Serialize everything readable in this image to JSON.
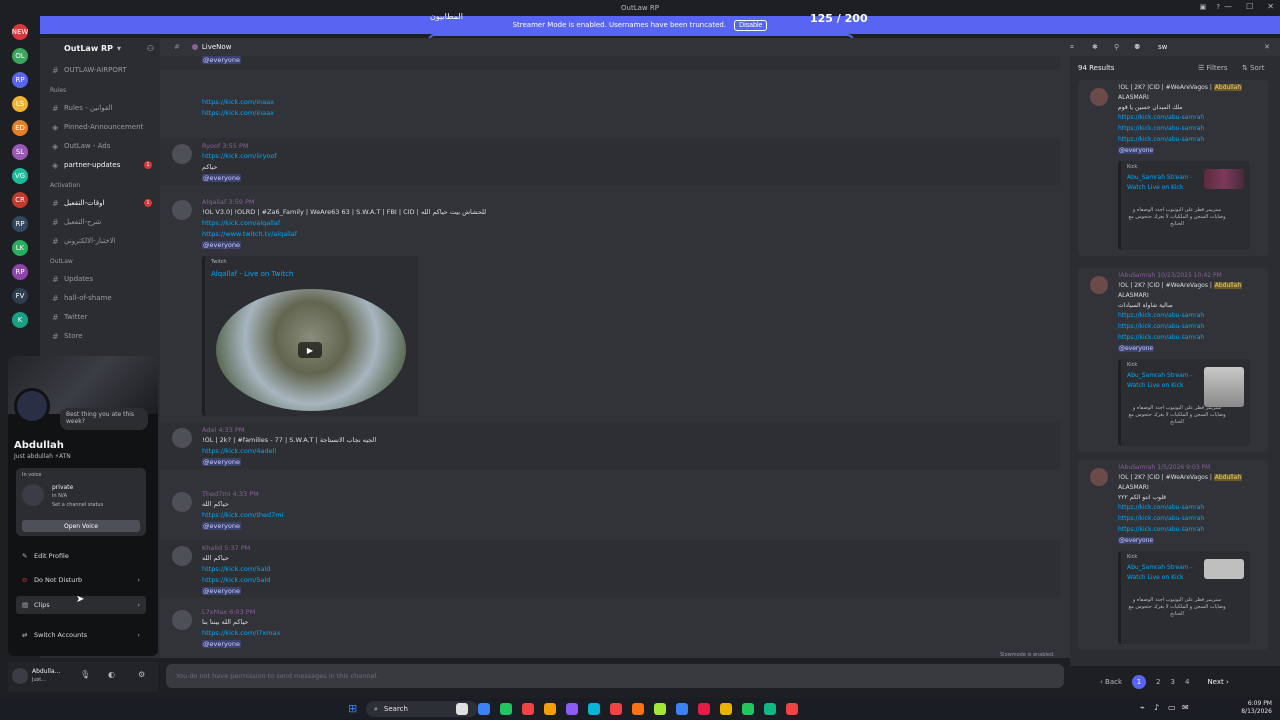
{
  "window": {
    "title": "OutLaw RP",
    "controls": [
      "—",
      "☐",
      "✕"
    ]
  },
  "banner": {
    "right_text": "المطابيون",
    "message": "Streamer Mode is enabled. Usernames have been truncated.",
    "disable_label": "Disable",
    "counter": "125 / 200",
    "progress_fraction": 0.62
  },
  "guilds": [
    "NEW",
    "OL",
    "RP",
    "LS",
    "ED",
    "SL",
    "VG",
    "CR",
    "RP",
    "LK",
    "RP",
    "FV",
    "K"
  ],
  "server": {
    "name": "OutLaw RP",
    "channels": [
      {
        "label": "OUTLAW-AIRPORT",
        "type": "text",
        "state": ""
      },
      {
        "label": "Rules",
        "type": "category",
        "state": ""
      },
      {
        "label": "Rules - القوانين",
        "type": "rules",
        "state": ""
      },
      {
        "label": "Pinned-Announcement",
        "type": "announce",
        "state": ""
      },
      {
        "label": "OutLaw - Ads",
        "type": "announce",
        "state": ""
      },
      {
        "label": "partner-updates",
        "type": "announce",
        "state": "unread",
        "badge": "1"
      },
      {
        "label": "Activation",
        "type": "category",
        "state": ""
      },
      {
        "label": "اوقات-التفعيل",
        "type": "text",
        "state": "unread",
        "badge": "1"
      },
      {
        "label": "شرح-التفعيل",
        "type": "text",
        "state": ""
      },
      {
        "label": "الاختبار-الالكتروني",
        "type": "text",
        "state": ""
      },
      {
        "label": "OutLaw",
        "type": "category",
        "state": ""
      },
      {
        "label": "Updates",
        "type": "text",
        "state": ""
      },
      {
        "label": "hall-of-shame",
        "type": "text",
        "state": ""
      },
      {
        "label": "Twitter",
        "type": "text",
        "state": ""
      },
      {
        "label": "Store",
        "type": "text",
        "state": ""
      }
    ]
  },
  "profile": {
    "status_bubble": "Best thing you ate this week?",
    "display_name": "Abdullah",
    "sub": "Just abdullah   ⚡ATN",
    "voice_label": "In voice",
    "voice_channel": "private",
    "voice_sub": "in N/A",
    "voice_status": "Set a channel status",
    "open_voice": "Open Voice",
    "menu": [
      "Edit Profile",
      "Do Not Disturb",
      "Clips",
      "Switch Accounts"
    ],
    "bottom_name": "Abdulla...",
    "bottom_sub": "Just..."
  },
  "chat": {
    "channel_name": "LiveNow",
    "messages": [
      {
        "name": "",
        "time": "",
        "lines": [
          {
            "t": "@everyone",
            "c": "mention"
          }
        ]
      },
      {
        "name": "",
        "time": "",
        "lines": [
          {
            "t": "https://kick.com/inaax",
            "c": "link"
          },
          {
            "t": "https://kick.com/inaax",
            "c": "link"
          }
        ]
      },
      {
        "name": "Ryoof",
        "time": "3:55 PM",
        "lines": [
          {
            "t": "https://kick.com/iiryoof",
            "c": "link"
          },
          {
            "t": "حياكم",
            "c": "white"
          },
          {
            "t": "@everyone",
            "c": "mention"
          }
        ]
      },
      {
        "name": "Alqallaf",
        "time": "3:59 PM",
        "lines": [
          {
            "t": "!OL V3.0| !OLRD | #Za6_Family | WeAre63 63 | S.W.A.T | FBI | CID |  للحشاش بيت حياكم الله",
            "c": "white"
          },
          {
            "t": "https://kick.com/alqallaf",
            "c": "link"
          },
          {
            "t": "https://www.twitch.tv/alqallaf",
            "c": "link"
          },
          {
            "t": "@everyone",
            "c": "mention"
          }
        ]
      },
      {
        "name": "Adel",
        "time": "4:33 PM",
        "lines": [
          {
            "t": "!OL | 2k? | #families - 77 | S.W.A.T |  الجيه نجاب الانستاجة",
            "c": "white"
          },
          {
            "t": "https://kick.com/4adel!",
            "c": "link"
          },
          {
            "t": "@everyone",
            "c": "mention"
          }
        ]
      },
      {
        "name": "Thed7mi",
        "time": "4:33 PM",
        "lines": [
          {
            "t": "حياكم الله",
            "c": "white"
          },
          {
            "t": "https://kick.com/thed7mi",
            "c": "link"
          },
          {
            "t": "@everyone",
            "c": "mention"
          }
        ]
      },
      {
        "name": "Khalid",
        "time": "5:37 PM",
        "lines": [
          {
            "t": "حياكم الله",
            "c": "white"
          },
          {
            "t": "https://kick.com/5ald",
            "c": "link"
          },
          {
            "t": "https://kick.com/5ald",
            "c": "link"
          },
          {
            "t": "@everyone",
            "c": "mention"
          }
        ]
      },
      {
        "name": "L7xMax",
        "time": "6:03 PM",
        "lines": [
          {
            "t": "حياكم الله بيننا بنا",
            "c": "white"
          },
          {
            "t": "https://kick.com/l7xmax",
            "c": "link"
          },
          {
            "t": "@everyone",
            "c": "mention"
          }
        ]
      }
    ],
    "embed": {
      "provider": "Twitch",
      "title": "Alqallaf - Live on Twitch"
    },
    "input_placeholder": "You do not have permission to send messages in this channel.",
    "slowmode": "Slowmode is enabled."
  },
  "search": {
    "query": "sw",
    "results_count": "94 Results",
    "filters_label": "Filters",
    "sort_label": "Sort",
    "results": [
      {
        "name": "",
        "time": "",
        "lines": [
          "!OL | 2K? |CID | #WeAreVagos | Abdullah",
          "ALASMARI",
          "ملك الميدان حسين يا قوم"
        ],
        "links": [
          "https://kick.com/abu-samrah",
          "https://kick.com/abu-samrah",
          "https://kick.com/abu-samrah"
        ],
        "mention": "@everyone",
        "embed": {
          "provider": "Kick",
          "title": "Abu_Samrah Stream - Watch Live on Kick",
          "desc": "ستريمر قطر على اليوتيوب اجدد الوصفاه و وصايات السجن و الملكيات لا يغرك حتحوس مع الحنانح"
        }
      },
      {
        "name": "!AbuSamrah",
        "time": "10/23/2025 10:42 PM",
        "lines": [
          "!OL | 2K? |CID | #WeAreVagos | Abdullah",
          "ALASMARI",
          "صالية شاولة السيادات"
        ],
        "links": [
          "https://kick.com/abu-samrah",
          "https://kick.com/abu-samrah",
          "https://kick.com/abu-samrah"
        ],
        "mention": "@everyone",
        "embed": {
          "provider": "Kick",
          "title": "Abu_Samrah Stream - Watch Live on Kick",
          "desc": "ستريمر قطر على اليوتيوب اجدد الوصفاه و وصايات السجن و الملكيات لا يغرك حتحوس مع الحنانح"
        }
      },
      {
        "name": "!AbuSamrah",
        "time": "1/5/2026 9:03 PM",
        "lines": [
          "!OL | 2K? |CID | #WeAreVagos | Abdullah",
          "ALASMARI",
          "قلوب انتو الكم ٢٢٢"
        ],
        "links": [
          "https://kick.com/abu-samrah",
          "https://kick.com/abu-samrah",
          "https://kick.com/abu-samrah"
        ],
        "mention": "@everyone",
        "embed": {
          "provider": "Kick",
          "title": "Abu_Samrah Stream - Watch Live on Kick",
          "desc": "ستريمر قطر على اليوتيوب اجدد الوصفاه و وصايات السجن و الملكيات لا يغرك حتحوس مع الحنانح"
        }
      }
    ],
    "pager": {
      "back": "Back",
      "pages": [
        "1",
        "2",
        "3",
        "4"
      ],
      "current": "1",
      "next": "Next"
    }
  },
  "taskbar": {
    "search_label": "Search",
    "time": "6:09 PM",
    "date": "8/13/2026",
    "icon_colors": [
      "#e0e0e0",
      "#3b82f6",
      "#22c55e",
      "#ef4444",
      "#f59e0b",
      "#8b5cf6",
      "#06b6d4",
      "#ef4444",
      "#f97316",
      "#a3e635",
      "#3b82f6",
      "#e11d48",
      "#eab308",
      "#22c55e",
      "#10b981",
      "#ef4444"
    ]
  },
  "colors": {
    "blurple": "#5865f2",
    "link": "#00a8fc",
    "bg": "#313338",
    "sidebar": "#2b2d31"
  }
}
